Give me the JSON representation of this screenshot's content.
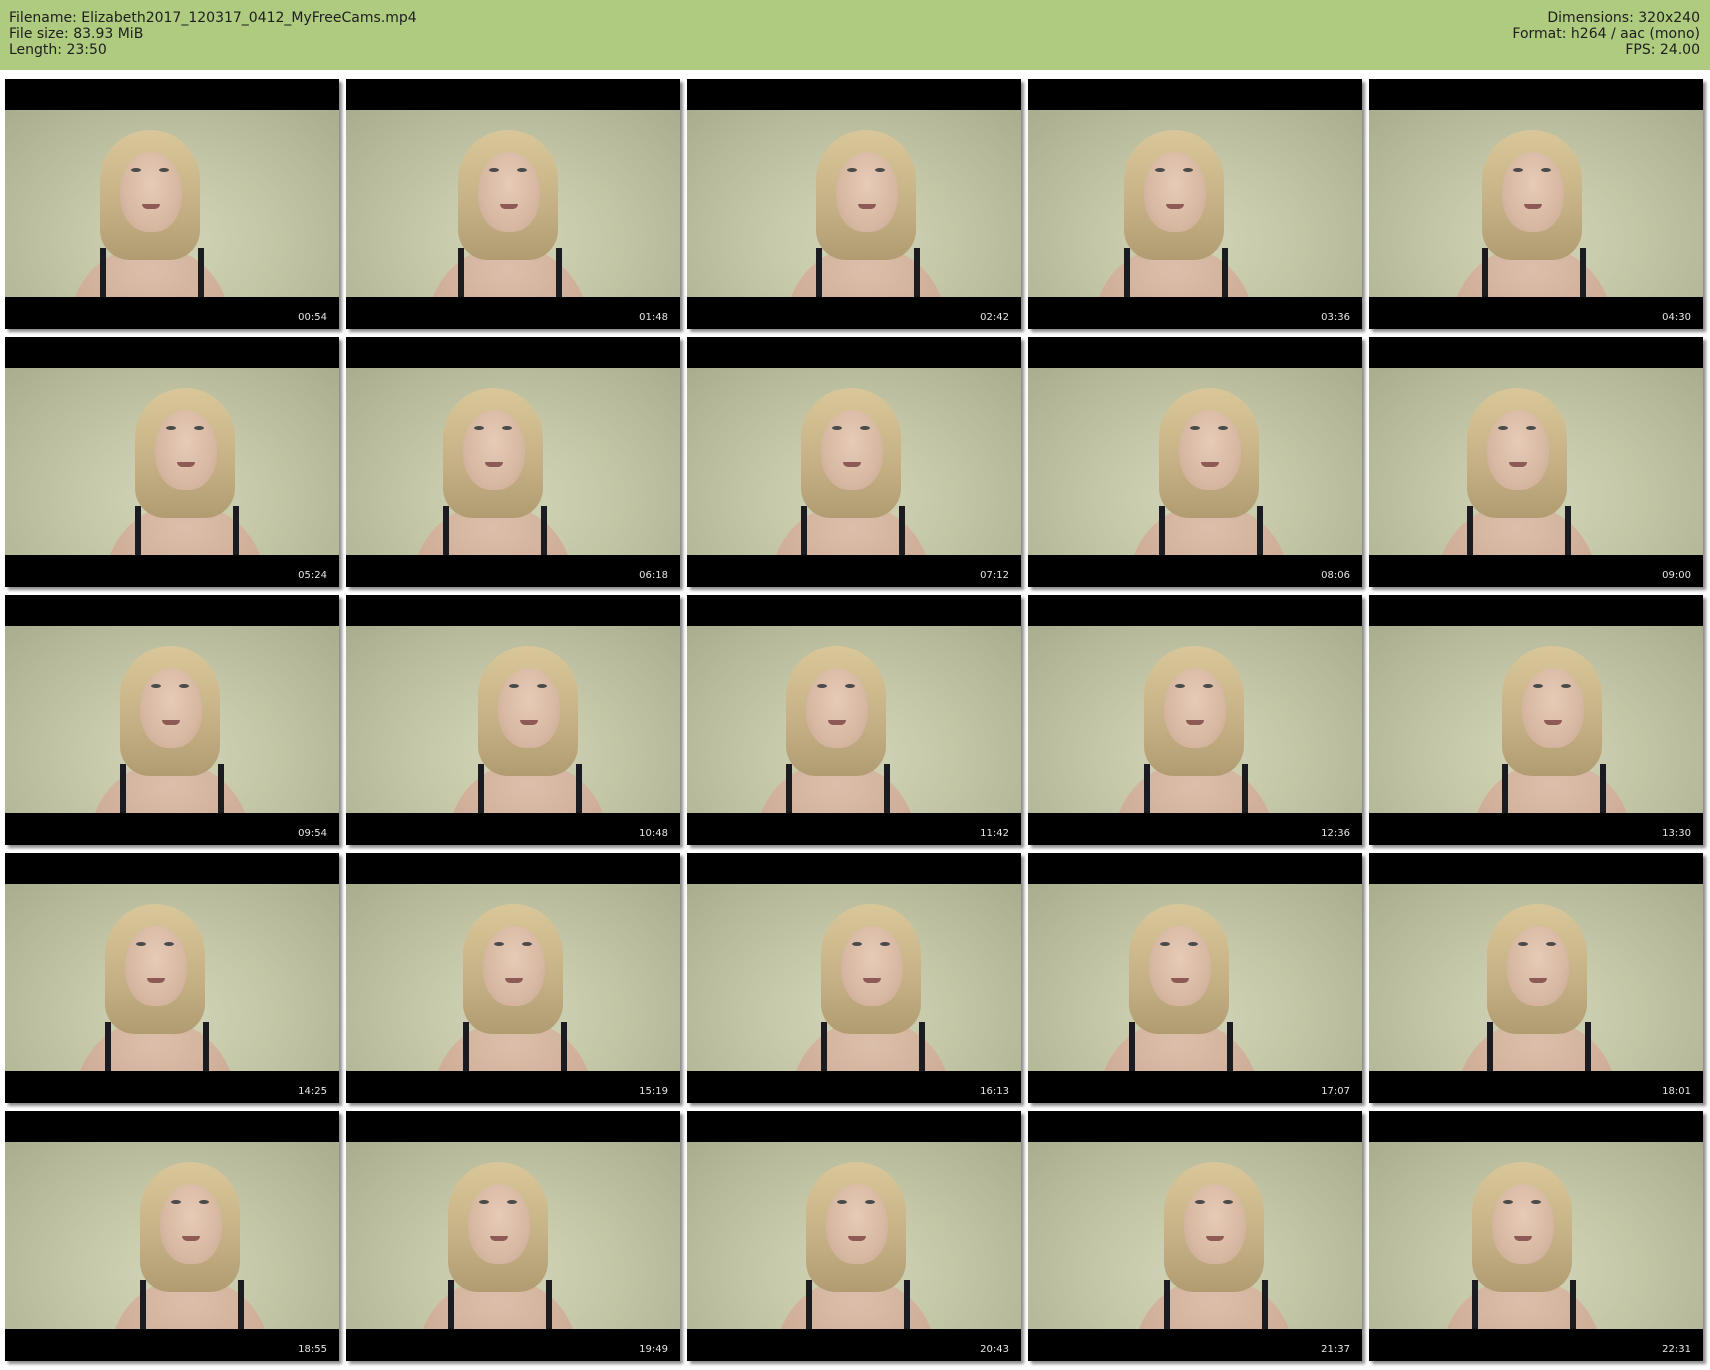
{
  "header": {
    "filename": "Filename: Elizabeth2017_120317_0412_MyFreeCams.mp4",
    "filesize": "File size: 83.93 MiB",
    "length": "Length: 23:50",
    "dimensions": "Dimensions: 320x240",
    "format": "Format: h264 / aac (mono)",
    "fps": "FPS: 24.00"
  },
  "colors": {
    "header_bg": "#aecb7f",
    "thumb_border": "#000000",
    "watermark": "#5a0f0f"
  },
  "thumbnails": [
    {
      "timestamp": "00:54"
    },
    {
      "timestamp": "01:48"
    },
    {
      "timestamp": "02:42"
    },
    {
      "timestamp": "03:36"
    },
    {
      "timestamp": "04:30"
    },
    {
      "timestamp": "05:24"
    },
    {
      "timestamp": "06:18"
    },
    {
      "timestamp": "07:12"
    },
    {
      "timestamp": "08:06"
    },
    {
      "timestamp": "09:00"
    },
    {
      "timestamp": "09:54"
    },
    {
      "timestamp": "10:48"
    },
    {
      "timestamp": "11:42"
    },
    {
      "timestamp": "12:36"
    },
    {
      "timestamp": "13:30"
    },
    {
      "timestamp": "14:25"
    },
    {
      "timestamp": "15:19"
    },
    {
      "timestamp": "16:13"
    },
    {
      "timestamp": "17:07"
    },
    {
      "timestamp": "18:01"
    },
    {
      "timestamp": "18:55"
    },
    {
      "timestamp": "19:49"
    },
    {
      "timestamp": "20:43"
    },
    {
      "timestamp": "21:37"
    },
    {
      "timestamp": "22:31"
    }
  ]
}
